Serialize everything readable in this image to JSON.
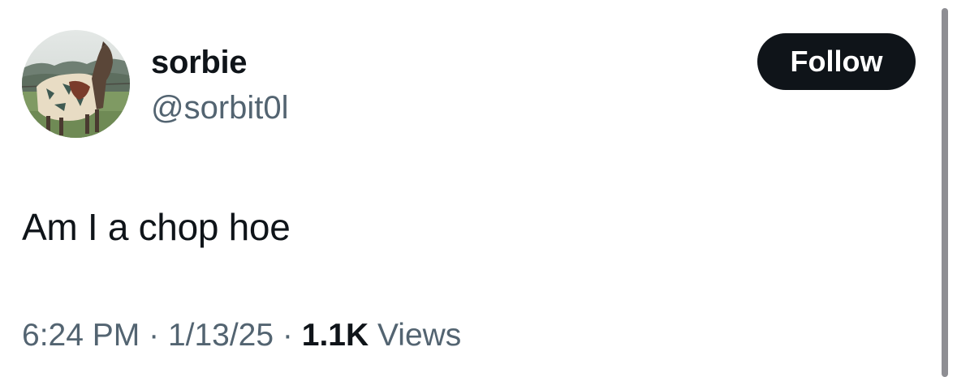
{
  "user": {
    "display_name": "sorbie",
    "handle": "@sorbit0l",
    "avatar_icon": "horse-avatar-photo"
  },
  "follow_button": {
    "label": "Follow"
  },
  "tweet": {
    "text": "Am I a chop hoe"
  },
  "meta": {
    "time": "6:24 PM",
    "separator": "·",
    "date": "1/13/25",
    "views_count": "1.1K",
    "views_label": "Views"
  },
  "colors": {
    "primary_text": "#0f1419",
    "secondary_text": "#536471",
    "button_bg": "#0f1419",
    "button_text": "#ffffff"
  }
}
